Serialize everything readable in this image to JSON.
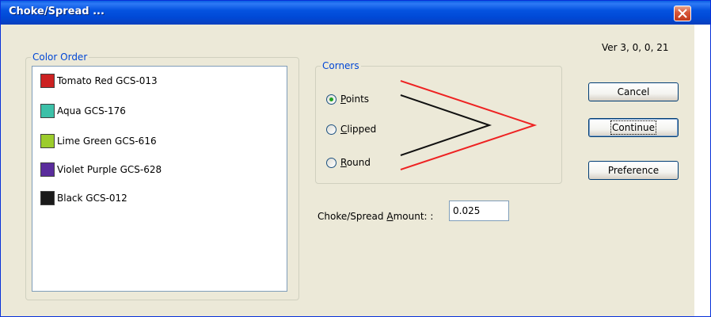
{
  "window": {
    "title": "Choke/Spread ...",
    "version": "Ver 3, 0, 0, 21"
  },
  "color_order": {
    "legend": "Color Order",
    "items": [
      {
        "label": "Tomato Red GCS-013",
        "color": "#cc2222"
      },
      {
        "label": "Aqua GCS-176",
        "color": "#3cc0a8"
      },
      {
        "label": "Lime Green GCS-616",
        "color": "#9ccc2c"
      },
      {
        "label": "Violet Purple GCS-628",
        "color": "#5a2c9c"
      },
      {
        "label": "Black GCS-012",
        "color": "#1a1a1a"
      }
    ]
  },
  "corners": {
    "legend": "Corners",
    "options": [
      {
        "label_pre": "",
        "label_key": "P",
        "label_post": "oints",
        "selected": true
      },
      {
        "label_pre": "",
        "label_key": "C",
        "label_post": "lipped",
        "selected": false
      },
      {
        "label_pre": "",
        "label_key": "R",
        "label_post": "ound",
        "selected": false
      }
    ],
    "outer_line_color": "#ee2222",
    "inner_line_color": "#111111"
  },
  "buttons": {
    "cancel": "Cancel",
    "continue": "Continue",
    "preference": "Preference"
  },
  "amount": {
    "label_pre": "Choke/Spread ",
    "label_key": "A",
    "label_post": "mount: :",
    "value": "0.025"
  },
  "colors": {
    "title_bar": "#0a5fe4",
    "dialog_bg": "#ece9d8",
    "legend_text": "#0046d5"
  }
}
